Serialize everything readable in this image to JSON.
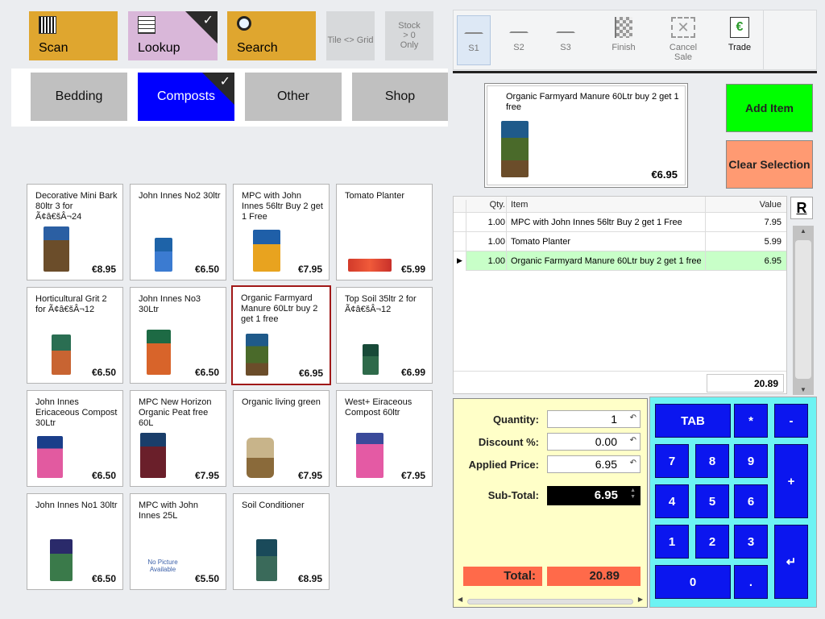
{
  "left": {
    "top_buttons": {
      "scan": "Scan",
      "lookup": "Lookup",
      "search": "Search",
      "tile_grid": "Tile <> Grid",
      "stock_only": "Stock > 0 Only"
    },
    "categories": [
      "Bedding",
      "Composts",
      "Other",
      "Shop"
    ],
    "products": [
      {
        "name": "Decorative Mini Bark 80ltr 3 for Ã¢â€šÂ¬24",
        "price": "€8.95"
      },
      {
        "name": "John Innes No2 30ltr",
        "price": "€6.50"
      },
      {
        "name": "MPC with John Innes 56ltr Buy 2 get 1 Free",
        "price": "€7.95"
      },
      {
        "name": "Tomato Planter",
        "price": "€5.99"
      },
      {
        "name": "Horticultural Grit 2 for Ã¢â€šÂ¬12",
        "price": "€6.50"
      },
      {
        "name": "John Innes No3 30Ltr",
        "price": "€6.50"
      },
      {
        "name": "Organic Farmyard Manure 60Ltr buy 2 get 1 free",
        "price": "€6.95"
      },
      {
        "name": "Top Soil 35ltr 2 for Ã¢â€šÂ¬12",
        "price": "€6.99"
      },
      {
        "name": "John Innes Ericaceous Compost 30Ltr",
        "price": "€6.50"
      },
      {
        "name": "MPC New Horizon Organic Peat free 60L",
        "price": "€7.95"
      },
      {
        "name": "Organic living green",
        "price": "€7.95"
      },
      {
        "name": "West+ Eiraceous Compost 60ltr",
        "price": "€7.95"
      },
      {
        "name": "John Innes No1 30ltr",
        "price": "€6.50"
      },
      {
        "name": "MPC with John Innes 25L",
        "price": "€5.50",
        "no_picture": "No Picture Available"
      },
      {
        "name": "Soil Conditioner",
        "price": "€8.95"
      }
    ]
  },
  "toolbar": {
    "s1": "S1",
    "s2": "S2",
    "s3": "S3",
    "finish": "Finish",
    "cancel_sale": "Cancel Sale",
    "trade": "Trade"
  },
  "preview": {
    "name": "Organic Farmyard Manure 60Ltr buy 2 get 1 free",
    "price": "€6.95"
  },
  "actions": {
    "add_item": "Add Item",
    "clear_selection": "Clear Selection"
  },
  "grid": {
    "headers": {
      "qty": "Qty.",
      "item": "Item",
      "value": "Value"
    },
    "rows": [
      {
        "qty": "1.00",
        "item": "MPC with John Innes 56ltr Buy 2 get 1 Free",
        "value": "7.95"
      },
      {
        "qty": "1.00",
        "item": "Tomato Planter",
        "value": "5.99"
      },
      {
        "qty": "1.00",
        "item": "Organic Farmyard Manure 60Ltr buy 2 get 1 free",
        "value": "6.95"
      }
    ],
    "total": "20.89",
    "r_label": "R"
  },
  "edit": {
    "quantity_label": "Quantity:",
    "quantity": "1",
    "discount_label": "Discount %:",
    "discount": "0.00",
    "price_label": "Applied Price:",
    "price": "6.95",
    "subtotal_label": "Sub-Total:",
    "subtotal": "6.95",
    "total_label": "Total:",
    "total": "20.89"
  },
  "keypad": {
    "tab": "TAB",
    "star": "*",
    "minus": "-",
    "plus": "+",
    "k7": "7",
    "k8": "8",
    "k9": "9",
    "k4": "4",
    "k5": "5",
    "k6": "6",
    "k1": "1",
    "k2": "2",
    "k3": "3",
    "k0": "0",
    "dot": ".",
    "enter": "↵"
  },
  "colors": {
    "gold": "#dfa62f",
    "active_category": "#0000ff",
    "add_item": "#00ff00",
    "clear_selection": "#ff9a72",
    "keypad_bg": "#6cf3f3",
    "key": "#0b16ef",
    "selected_row": "#c8ffc8"
  }
}
